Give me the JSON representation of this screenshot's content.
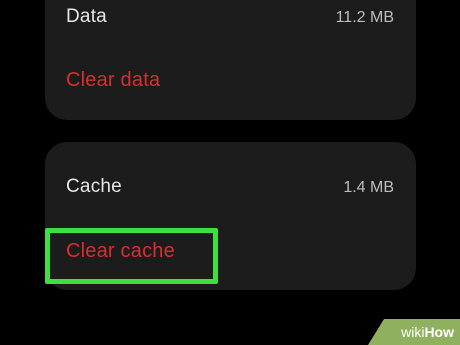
{
  "storage": {
    "data": {
      "label": "Data",
      "size": "11.2 MB",
      "action": "Clear data"
    },
    "cache": {
      "label": "Cache",
      "size": "1.4 MB",
      "action": "Clear cache"
    }
  },
  "highlight_color": "#3ee03e",
  "action_color": "#d62f2f",
  "watermark": {
    "prefix": "wiki",
    "suffix": "How"
  }
}
